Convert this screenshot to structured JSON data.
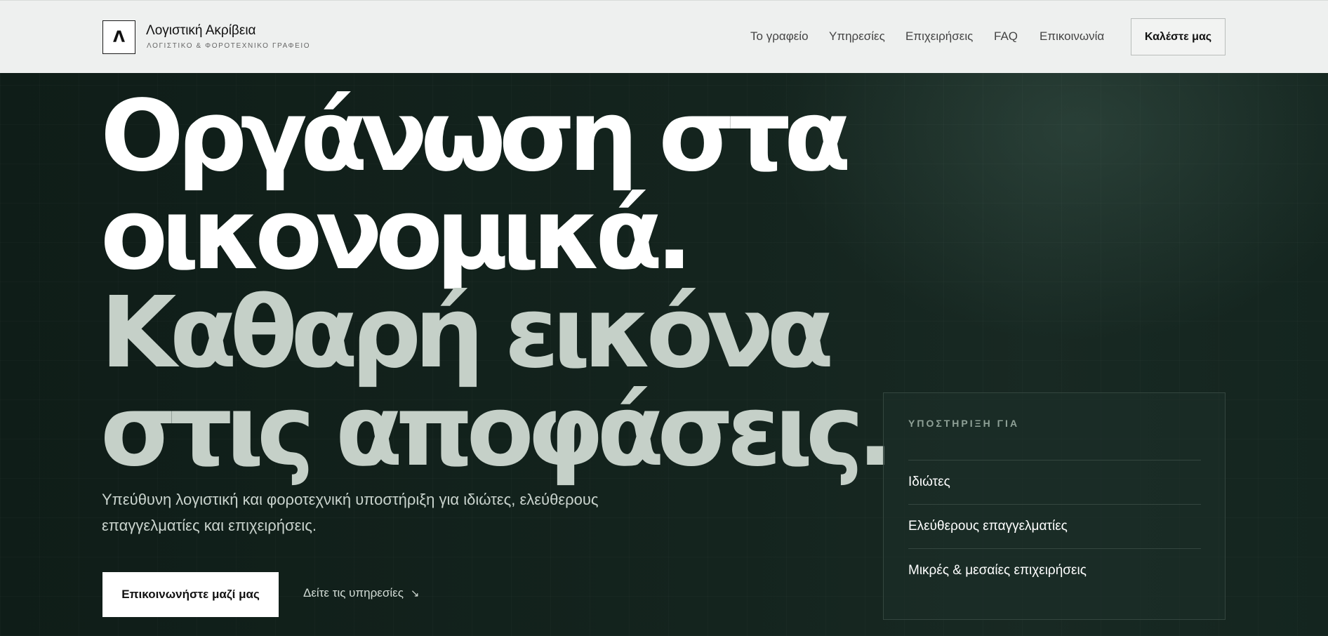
{
  "brand": {
    "logo_glyph": "Λ",
    "name": "Λογιστική Ακρίβεια",
    "subtitle": "ΛΟΓΙΣΤΙΚΟ & ΦΟΡΟΤΕΧΝΙΚΟ ΓΡΑΦΕΙΟ"
  },
  "nav": {
    "items": [
      {
        "label": "Το γραφείο"
      },
      {
        "label": "Υπηρεσίες"
      },
      {
        "label": "Επιχειρήσεις"
      },
      {
        "label": "FAQ"
      },
      {
        "label": "Επικοινωνία"
      }
    ],
    "cta_label": "Καλέστε μας"
  },
  "hero": {
    "headline_lines": [
      "Οργάνωση στα",
      "οικονομικά.",
      "Καθαρή εικόνα",
      "στις αποφάσεις."
    ],
    "subtitle": "Υπεύθυνη λογιστική και φοροτεχνική υποστήριξη για ιδιώτες, ελεύθερους επαγγελματίες και επιχειρήσεις.",
    "primary_cta": "Επικοινωνήστε μαζί μας",
    "secondary_cta": "Δείτε τις υπηρεσίες",
    "secondary_icon": "arrow-down-right-icon"
  },
  "support": {
    "title": "ΥΠΟΣΤΗΡΙΞΗ ΓΙΑ",
    "items": [
      {
        "label": "Ιδιώτες"
      },
      {
        "label": "Ελεύθερους επαγγελματίες"
      },
      {
        "label": "Μικρές & μεσαίες επιχειρήσεις"
      }
    ]
  },
  "colors": {
    "header_bg": "#eef0ef",
    "hero_bg": "#12221c",
    "headline_white": "#ffffff",
    "headline_muted": "#c5d0c8",
    "card_border": "#34463f"
  }
}
